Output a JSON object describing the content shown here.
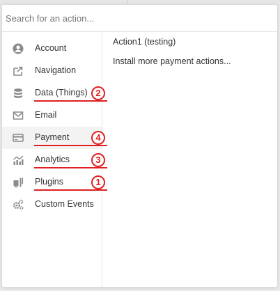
{
  "search": {
    "placeholder": "Search for an action..."
  },
  "sidebar": {
    "items": [
      {
        "label": "Account",
        "icon": "account-icon"
      },
      {
        "label": "Navigation",
        "icon": "navigation-icon"
      },
      {
        "label": "Data (Things)",
        "icon": "database-icon",
        "badge": "2"
      },
      {
        "label": "Email",
        "icon": "email-icon"
      },
      {
        "label": "Payment",
        "icon": "payment-icon",
        "badge": "4",
        "selected": true
      },
      {
        "label": "Analytics",
        "icon": "analytics-icon",
        "badge": "3"
      },
      {
        "label": "Plugins",
        "icon": "plugin-icon",
        "badge": "1"
      },
      {
        "label": "Custom Events",
        "icon": "gears-icon"
      }
    ]
  },
  "actions": [
    "Action1 (testing)",
    "Install more payment actions..."
  ],
  "colors": {
    "annotation": "#e02020",
    "icon": "#8a8a8a",
    "selected_bg": "#f3f3f3"
  }
}
